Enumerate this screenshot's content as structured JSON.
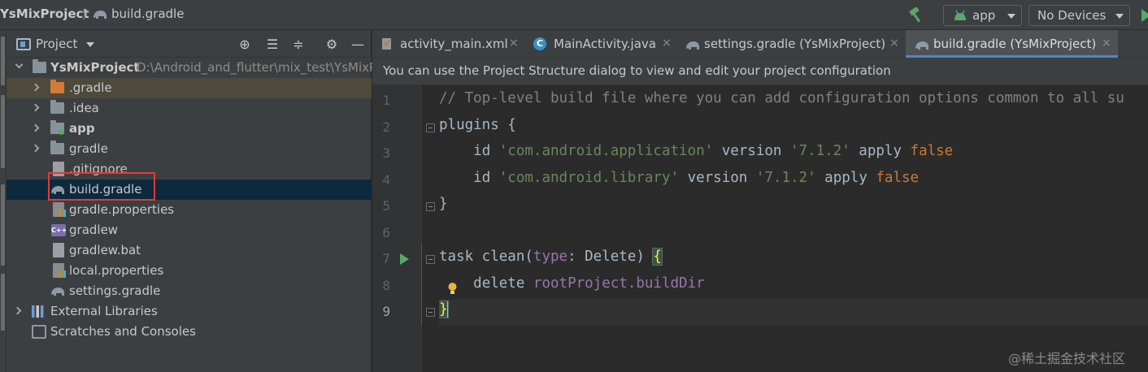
{
  "navbar": {
    "project_name": "YsMixProject",
    "separator": "〉",
    "current_file": "build.gradle",
    "run_config": "app",
    "device_selector": "No Devices"
  },
  "project_panel": {
    "title": "Project",
    "tree": [
      {
        "label": "YsMixProject",
        "path": "D:\\Android_and_flutter\\mix_test\\YsMixP",
        "type": "module-root",
        "expanded": true
      },
      {
        "label": ".gradle",
        "type": "folder-excluded",
        "expanded": false
      },
      {
        "label": ".idea",
        "type": "folder",
        "expanded": false
      },
      {
        "label": "app",
        "type": "module",
        "expanded": false
      },
      {
        "label": "gradle",
        "type": "folder",
        "expanded": false
      },
      {
        "label": ".gitignore",
        "type": "file"
      },
      {
        "label": "build.gradle",
        "type": "gradle",
        "selected": true
      },
      {
        "label": "gradle.properties",
        "type": "properties"
      },
      {
        "label": "gradlew",
        "type": "script"
      },
      {
        "label": "gradlew.bat",
        "type": "file"
      },
      {
        "label": "local.properties",
        "type": "properties"
      },
      {
        "label": "settings.gradle",
        "type": "gradle"
      },
      {
        "label": "External Libraries",
        "type": "libraries",
        "expanded": false
      },
      {
        "label": "Scratches and Consoles",
        "type": "scratches"
      }
    ]
  },
  "editor": {
    "tabs": [
      {
        "label": "activity_main.xml",
        "icon": "xml-file-icon",
        "active": false
      },
      {
        "label": "MainActivity.java",
        "icon": "java-class-icon",
        "active": false
      },
      {
        "label": "settings.gradle (YsMixProject)",
        "icon": "gradle-icon",
        "active": false
      },
      {
        "label": "build.gradle (YsMixProject)",
        "icon": "gradle-icon",
        "active": true
      }
    ],
    "close_glyph": "×",
    "notice": "You can use the Project Structure dialog to view and edit your project configuration",
    "line_numbers": [
      "1",
      "2",
      "3",
      "4",
      "5",
      "6",
      "7",
      "8",
      "9"
    ],
    "current_line": 9,
    "code": {
      "l1_comment": "// Top-level build file where you can add configuration options common to all su",
      "l2_plugins": "plugins {",
      "l3_indent": "    ",
      "l3_id": "id ",
      "l3_str": "'com.android.application'",
      "l3_version": " version ",
      "l3_ver": "'7.1.2'",
      "l3_apply": " apply ",
      "l3_false": "false",
      "l4_indent": "    ",
      "l4_id": "id ",
      "l4_str": "'com.android.library'",
      "l4_version": " version ",
      "l4_ver": "'7.1.2'",
      "l4_apply": " apply ",
      "l4_false": "false",
      "l5_close": "}",
      "l7_task": "task clean(",
      "l7_type": "type",
      "l7_rest": ": Delete) ",
      "l7_brace": "{",
      "l8_indent": "    ",
      "l8_delete": "delete ",
      "l8_prop": "rootProject.buildDir",
      "l9_brace": "}"
    }
  },
  "watermark": "@稀土掘金技术社区",
  "colors": {
    "background": "#2b2b2b",
    "panel": "#3c3f41",
    "selection": "#0d293e",
    "accent_tab": "#4a88c7",
    "red_annotation": "#e53935",
    "keyword": "#cc7832",
    "string": "#6a8759",
    "comment": "#808080",
    "property": "#9876aa",
    "run_green": "#59a869"
  }
}
